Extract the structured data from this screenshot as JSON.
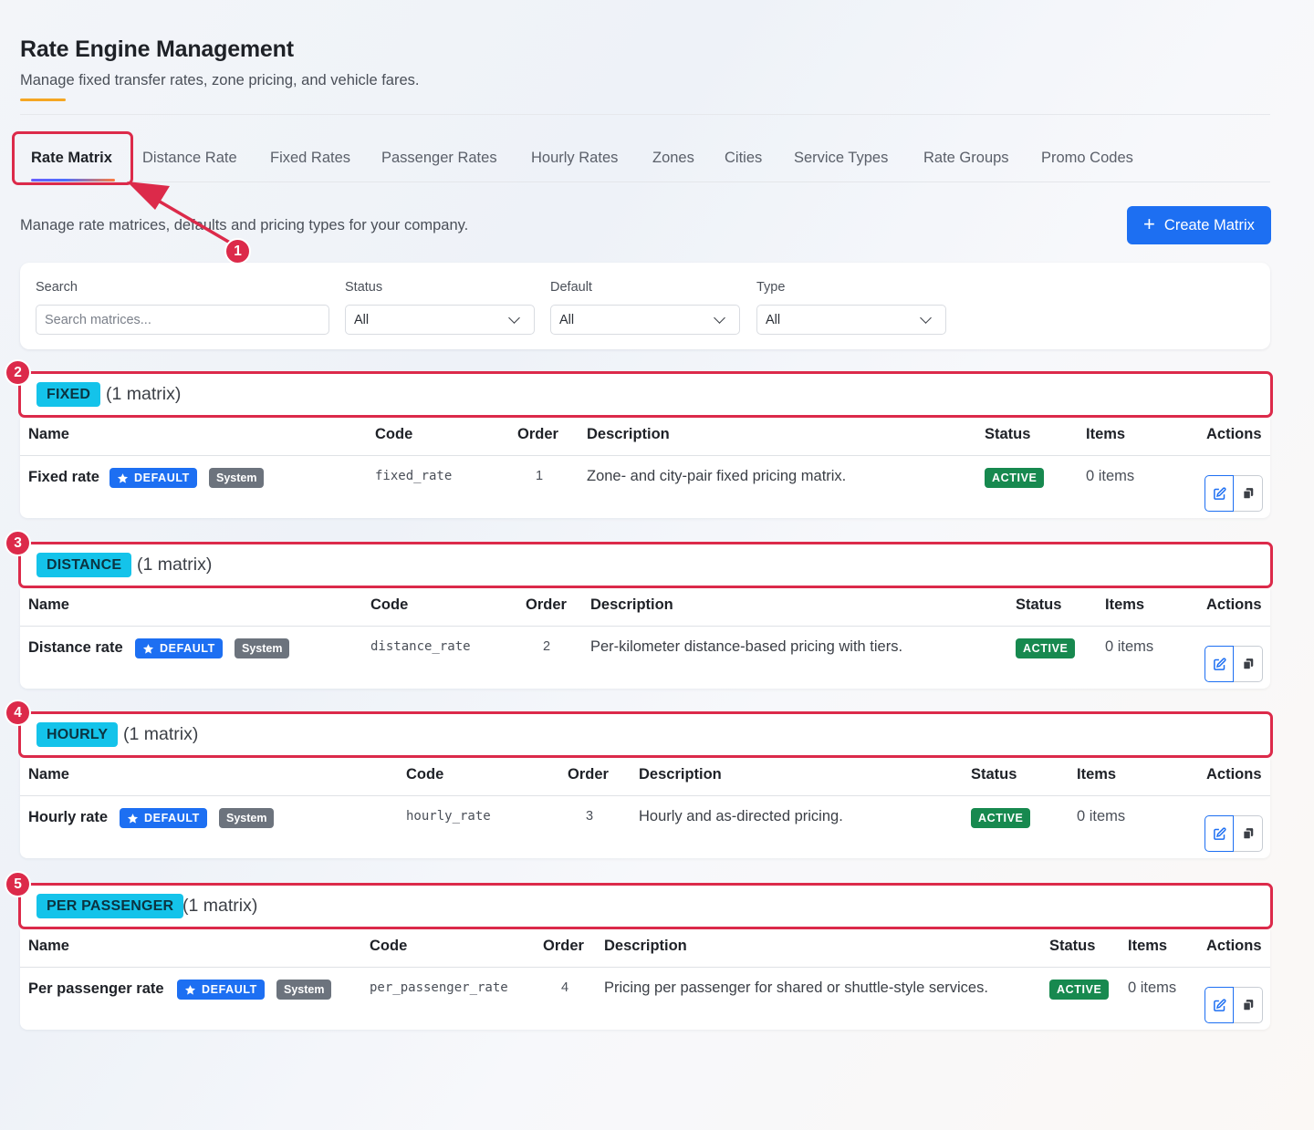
{
  "header": {
    "title": "Rate Engine Management",
    "subtitle": "Manage fixed transfer rates, zone pricing, and vehicle fares."
  },
  "tabs": [
    {
      "label": "Rate Matrix",
      "active": true
    },
    {
      "label": "Distance Rate"
    },
    {
      "label": "Fixed Rates"
    },
    {
      "label": "Passenger Rates"
    },
    {
      "label": "Hourly Rates"
    },
    {
      "label": "Zones"
    },
    {
      "label": "Cities"
    },
    {
      "label": "Service Types"
    },
    {
      "label": "Rate Groups"
    },
    {
      "label": "Promo Codes"
    }
  ],
  "toolbar": {
    "description": "Manage rate matrices, defaults and pricing types for your company.",
    "create_label": "Create Matrix"
  },
  "filters": {
    "search_label": "Search",
    "search_placeholder": "Search matrices...",
    "status_label": "Status",
    "status_value": "All",
    "default_label": "Default",
    "default_value": "All",
    "type_label": "Type",
    "type_value": "All"
  },
  "columns": {
    "name": "Name",
    "code": "Code",
    "order": "Order",
    "description": "Description",
    "status": "Status",
    "items": "Items",
    "actions": "Actions"
  },
  "badges": {
    "default": "DEFAULT",
    "system": "System"
  },
  "groups": [
    {
      "marker": "1",
      "type_label": "FIXED",
      "count": "(1 matrix)",
      "row": {
        "name": "Fixed rate",
        "code": "fixed_rate",
        "order": "1",
        "description": "Zone- and city-pair fixed pricing matrix.",
        "status": "ACTIVE",
        "items": "0 items"
      }
    },
    {
      "type_label": "DISTANCE",
      "count": "(1 matrix)",
      "row": {
        "name": "Distance rate",
        "code": "distance_rate",
        "order": "2",
        "description": "Per-kilometer distance-based pricing with tiers.",
        "status": "ACTIVE",
        "items": "0 items"
      }
    },
    {
      "type_label": "HOURLY",
      "count": "(1 matrix)",
      "row": {
        "name": "Hourly rate",
        "code": "hourly_rate",
        "order": "3",
        "description": "Hourly and as-directed pricing.",
        "status": "ACTIVE",
        "items": "0 items"
      }
    },
    {
      "type_label": "PER PASSENGER",
      "count": "(1 matrix)",
      "row": {
        "name": "Per passenger rate",
        "code": "per_passenger_rate",
        "order": "4",
        "description": "Pricing per passenger for shared or shuttle-style services.",
        "status": "ACTIVE",
        "items": "0 items"
      }
    }
  ],
  "annotations": [
    "1",
    "2",
    "3",
    "4",
    "5"
  ],
  "colors": {
    "primary": "#1d6ff2",
    "group_badge": "#14c3ea",
    "active": "#17894f",
    "system": "#6c737d",
    "annotation": "#dc2a4a",
    "title_accent": "#f5a623"
  },
  "icons": {
    "create": "plus-icon",
    "default_badge": "star-icon",
    "select": "chevron-down-icon",
    "edit": "edit-icon",
    "copy": "copy-icon"
  }
}
